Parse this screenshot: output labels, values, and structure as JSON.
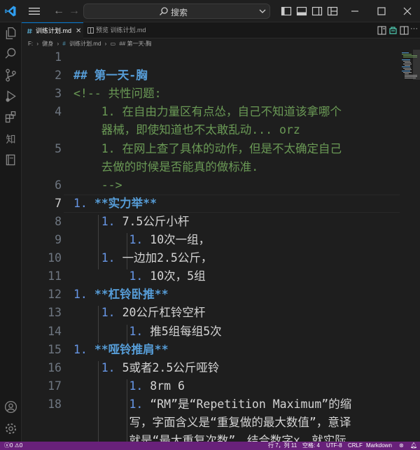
{
  "titlebar": {
    "search_label": "搜索"
  },
  "tabs": [
    {
      "label": "训练计划.md",
      "active": true
    },
    {
      "label": "预览 训练计划.md",
      "active": false
    }
  ],
  "breadcrumb": {
    "drive": "F:",
    "folder": "健身",
    "file": "训练计划.md",
    "symbol": "## 第一天-胸"
  },
  "editor": {
    "current_line": 7,
    "lines": [
      {
        "n": "1",
        "parts": []
      },
      {
        "n": "2",
        "parts": [
          {
            "t": "## 第一天-胸",
            "c": "c-heading"
          }
        ]
      },
      {
        "n": "3",
        "parts": [
          {
            "t": "<!-- 共性问题:",
            "c": "c-comment"
          }
        ]
      },
      {
        "n": "4",
        "parts": [
          {
            "t": "    1. 在自由力量区有点怂，自己不知道该拿哪个",
            "c": "c-comment"
          }
        ]
      },
      {
        "n": "",
        "parts": [
          {
            "t": "    器械，即使知道也不太敢乱动... orz",
            "c": "c-comment"
          }
        ]
      },
      {
        "n": "5",
        "parts": [
          {
            "t": "    1. 在网上查了具体的动作，但是不太确定自己",
            "c": "c-comment"
          }
        ]
      },
      {
        "n": "",
        "parts": [
          {
            "t": "    去做的时候是否能真的做标准.",
            "c": "c-comment"
          }
        ]
      },
      {
        "n": "6",
        "parts": [
          {
            "t": "    -->",
            "c": "c-comment"
          }
        ]
      },
      {
        "n": "7",
        "parts": [
          {
            "t": "1. ",
            "c": "c-list"
          },
          {
            "t": "**实力举**",
            "c": "c-bold"
          }
        ]
      },
      {
        "n": "8",
        "parts": [
          {
            "t": "    ",
            "c": "c-text"
          },
          {
            "t": "1. ",
            "c": "c-list"
          },
          {
            "t": "7.5公斤小杆",
            "c": "c-text"
          }
        ]
      },
      {
        "n": "9",
        "parts": [
          {
            "t": "        ",
            "c": "c-text"
          },
          {
            "t": "1. ",
            "c": "c-list"
          },
          {
            "t": "10次一组，",
            "c": "c-text"
          }
        ]
      },
      {
        "n": "10",
        "parts": [
          {
            "t": "    ",
            "c": "c-text"
          },
          {
            "t": "1. ",
            "c": "c-list"
          },
          {
            "t": "一边加2.5公斤，",
            "c": "c-text"
          }
        ]
      },
      {
        "n": "11",
        "parts": [
          {
            "t": "        ",
            "c": "c-text"
          },
          {
            "t": "1. ",
            "c": "c-list"
          },
          {
            "t": "10次，5组",
            "c": "c-text"
          }
        ]
      },
      {
        "n": "12",
        "parts": [
          {
            "t": "1. ",
            "c": "c-list"
          },
          {
            "t": "**杠铃卧推**",
            "c": "c-bold"
          }
        ]
      },
      {
        "n": "13",
        "parts": [
          {
            "t": "    ",
            "c": "c-text"
          },
          {
            "t": "1. ",
            "c": "c-list"
          },
          {
            "t": "20公斤杠铃空杆",
            "c": "c-text"
          }
        ]
      },
      {
        "n": "14",
        "parts": [
          {
            "t": "        ",
            "c": "c-text"
          },
          {
            "t": "1. ",
            "c": "c-list"
          },
          {
            "t": "推5组每组5次",
            "c": "c-text"
          }
        ]
      },
      {
        "n": "15",
        "parts": [
          {
            "t": "1. ",
            "c": "c-list"
          },
          {
            "t": "**哑铃推肩**",
            "c": "c-bold"
          }
        ]
      },
      {
        "n": "16",
        "parts": [
          {
            "t": "    ",
            "c": "c-text"
          },
          {
            "t": "1. ",
            "c": "c-list"
          },
          {
            "t": "5或者2.5公斤哑铃",
            "c": "c-text"
          }
        ]
      },
      {
        "n": "17",
        "parts": [
          {
            "t": "        ",
            "c": "c-text"
          },
          {
            "t": "1. ",
            "c": "c-list"
          },
          {
            "t": "8rm 6",
            "c": "c-text"
          }
        ]
      },
      {
        "n": "18",
        "parts": [
          {
            "t": "        ",
            "c": "c-text"
          },
          {
            "t": "1. ",
            "c": "c-list"
          },
          {
            "t": "“RM”是“Repetition Maximum”的缩",
            "c": "c-text"
          }
        ]
      },
      {
        "n": "",
        "parts": [
          {
            "t": "        写，字面含义是“重复做的最大数值”，意译",
            "c": "c-text"
          }
        ]
      },
      {
        "n": "",
        "parts": [
          {
            "t": "        就是“最大重复次数”，结合数字x，就实际",
            "c": "c-text"
          }
        ]
      }
    ]
  },
  "statusbar": {
    "errors": "0",
    "warnings": "0",
    "position": "行 7，列 11",
    "spaces": "空格: 4",
    "encoding": "UTF-8",
    "eol": "CRLF",
    "language": "Markdown"
  },
  "colors": {
    "accent": "#0078d4",
    "statusbar": "#68217a",
    "heading": "#569cd6",
    "comment": "#6a9955",
    "list_marker": "#6796e6"
  }
}
